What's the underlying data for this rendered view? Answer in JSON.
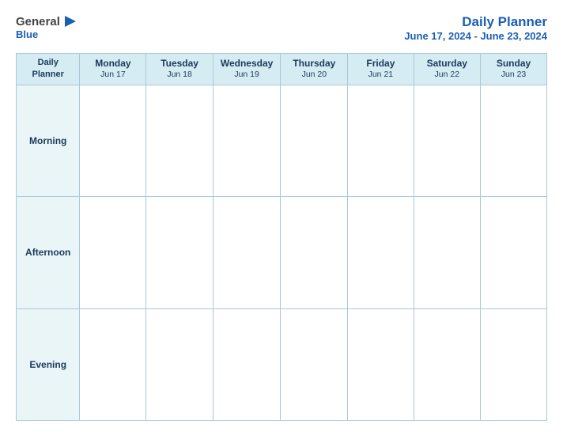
{
  "logo": {
    "brand": "General",
    "brand_color": "Blue",
    "icon": "▶"
  },
  "header": {
    "title": "Daily Planner",
    "subtitle": "June 17, 2024 - June 23, 2024"
  },
  "table": {
    "corner_label_line1": "Daily",
    "corner_label_line2": "Planner",
    "columns": [
      {
        "day": "Monday",
        "date": "Jun 17"
      },
      {
        "day": "Tuesday",
        "date": "Jun 18"
      },
      {
        "day": "Wednesday",
        "date": "Jun 19"
      },
      {
        "day": "Thursday",
        "date": "Jun 20"
      },
      {
        "day": "Friday",
        "date": "Jun 21"
      },
      {
        "day": "Saturday",
        "date": "Jun 22"
      },
      {
        "day": "Sunday",
        "date": "Jun 23"
      }
    ],
    "rows": [
      {
        "label": "Morning"
      },
      {
        "label": "Afternoon"
      },
      {
        "label": "Evening"
      }
    ]
  }
}
